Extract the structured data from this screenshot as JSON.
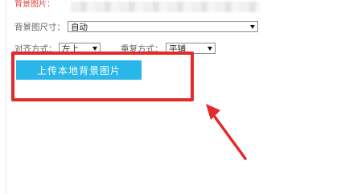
{
  "form": {
    "background_image_label": "背景图片：",
    "size_label": "背景图尺寸：",
    "size_value": "自动",
    "align_label": "对齐方式：",
    "align_value": "左上",
    "repeat_label": "重复方式：",
    "repeat_value": "平铺"
  },
  "upload": {
    "label": "上传本地背景图片"
  },
  "colors": {
    "accent": "#29b6e8",
    "highlight": "#e22a2a"
  }
}
